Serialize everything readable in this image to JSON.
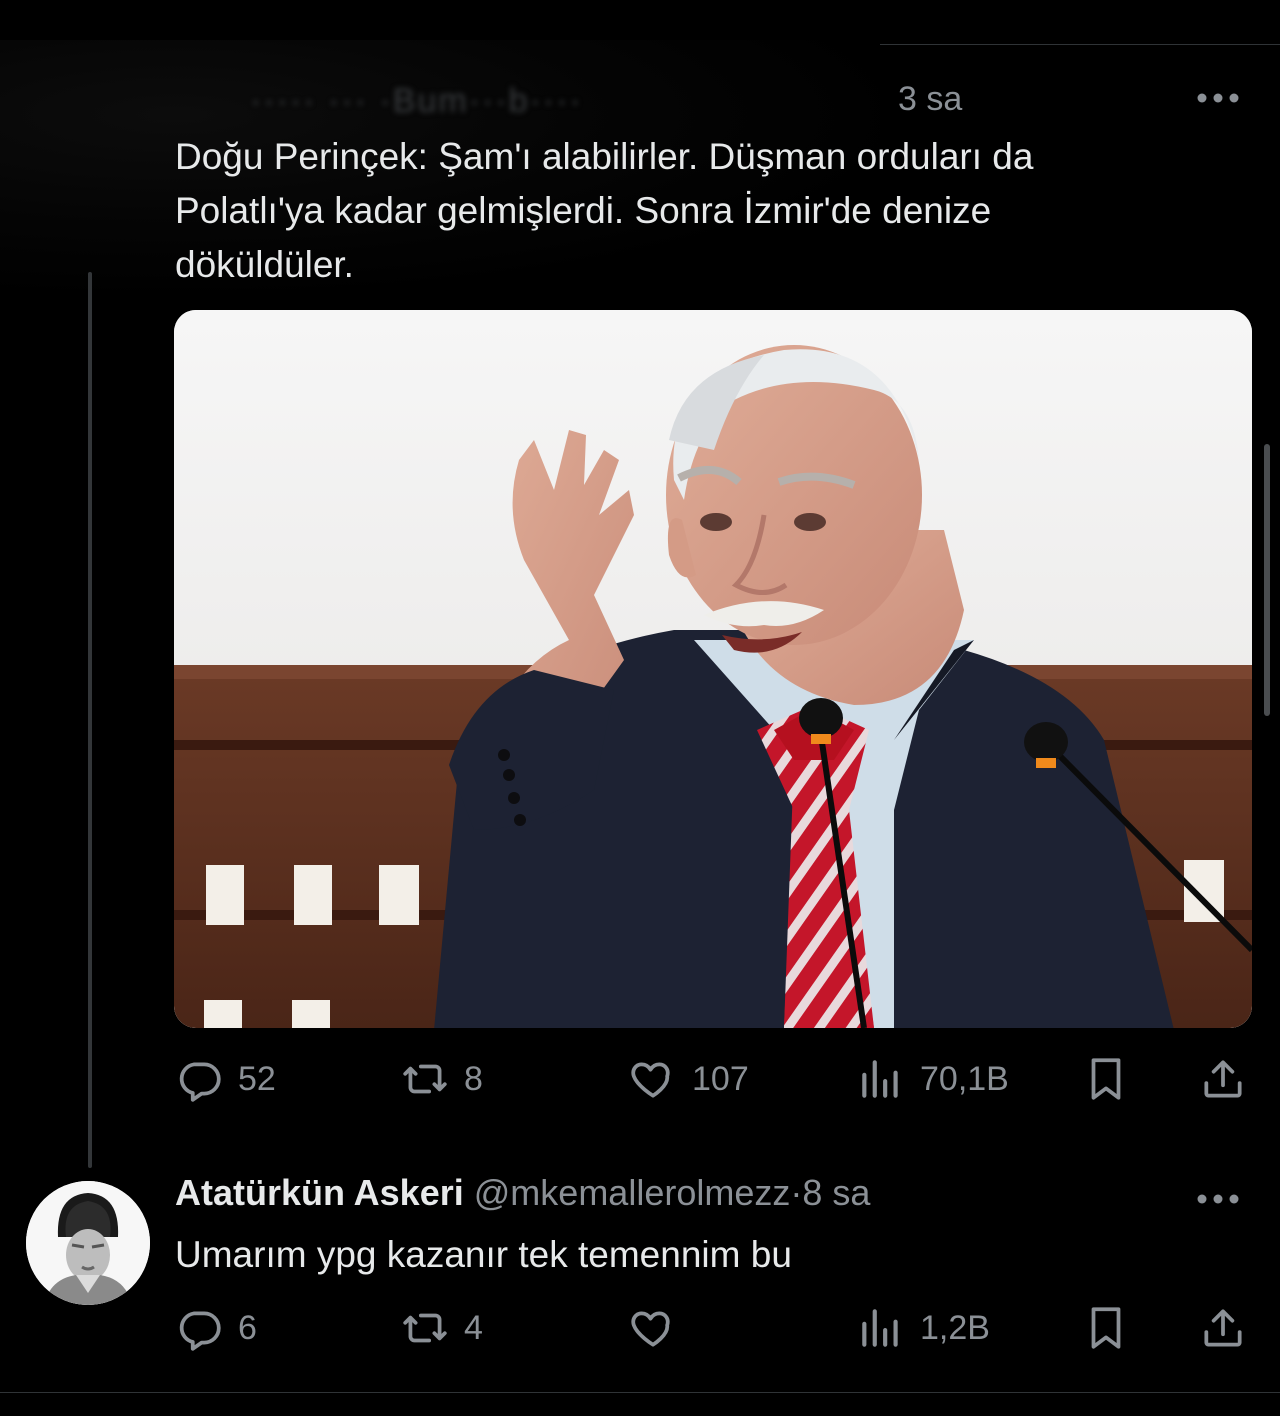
{
  "tweet": {
    "obscured_header": "····· ···  ·Bum···b····",
    "time": "3 sa",
    "text": "Doğu Perinçek: Şam'ı alabilirler. Düşman orduları da\nPolatlı'ya kadar gelmişlerdi. Sonra İzmir'de denize\ndöküldüler.",
    "stats": {
      "replies": "52",
      "retweets": "8",
      "likes": "107",
      "views": "70,1B"
    }
  },
  "reply": {
    "name": "Atatürkün Askeri",
    "handle": "@mkemallerolmezz",
    "separator": "·",
    "time": "8 sa",
    "text": "Umarım ypg kazanır tek temennim bu",
    "stats": {
      "replies": "6",
      "retweets": "4",
      "likes": "",
      "views": "1,2B"
    }
  },
  "colors": {
    "background": "#000000",
    "text": "#e7e9ea",
    "secondary": "#8b9096",
    "divider": "#2f3336"
  },
  "icons": [
    "more-icon",
    "reply-icon",
    "retweet-icon",
    "like-icon",
    "views-icon",
    "bookmark-icon",
    "share-icon"
  ]
}
